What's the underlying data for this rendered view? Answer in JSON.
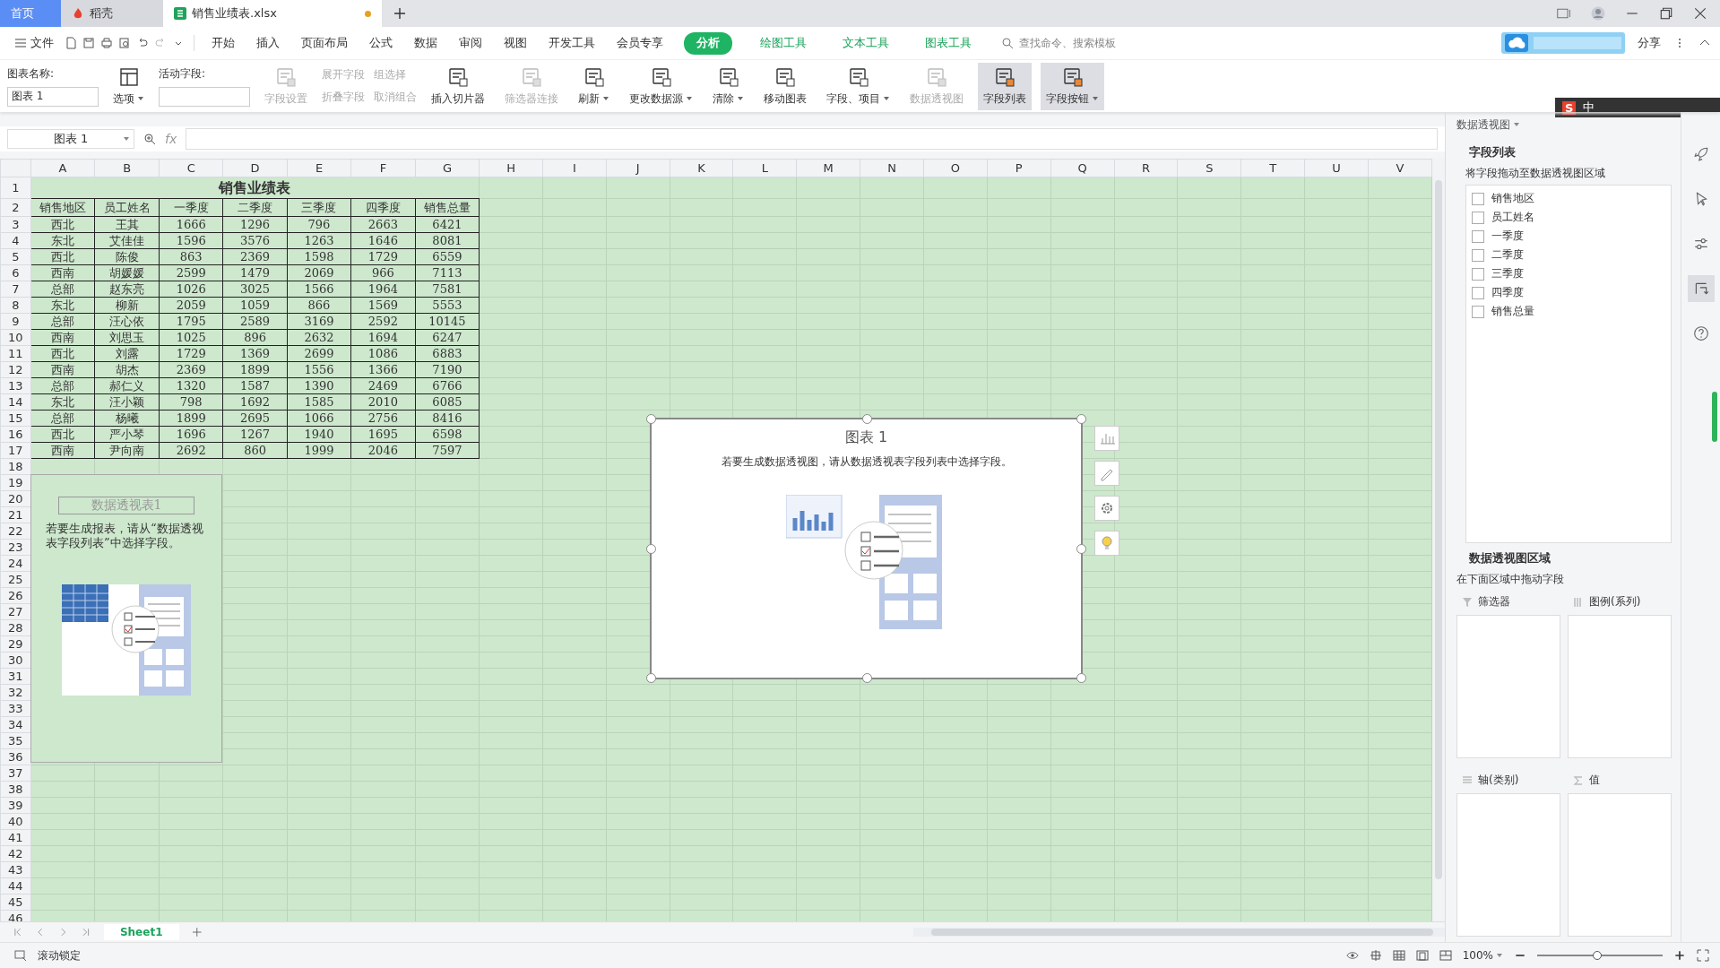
{
  "tabs": [
    {
      "label": "首页",
      "selected": false,
      "kind": "home"
    },
    {
      "label": "稻壳",
      "selected": false,
      "kind": "docer"
    },
    {
      "label": "销售业绩表.xlsx",
      "selected": true,
      "kind": "sheet",
      "unsaved": true
    }
  ],
  "menu": {
    "file": "文件",
    "items": [
      {
        "label": "开始",
        "kind": "normal",
        "selected": false
      },
      {
        "label": "插入",
        "kind": "normal",
        "selected": false
      },
      {
        "label": "页面布局",
        "kind": "normal",
        "selected": false
      },
      {
        "label": "公式",
        "kind": "normal",
        "selected": false
      },
      {
        "label": "数据",
        "kind": "normal",
        "selected": false
      },
      {
        "label": "审阅",
        "kind": "normal",
        "selected": false
      },
      {
        "label": "视图",
        "kind": "normal",
        "selected": false
      },
      {
        "label": "开发工具",
        "kind": "normal",
        "selected": false
      },
      {
        "label": "会员专享",
        "kind": "normal",
        "selected": false
      },
      {
        "label": "分析",
        "kind": "context",
        "selected": true
      },
      {
        "label": "绘图工具",
        "kind": "context",
        "selected": false
      },
      {
        "label": "文本工具",
        "kind": "context",
        "selected": false
      },
      {
        "label": "图表工具",
        "kind": "context",
        "selected": false
      }
    ],
    "search_placeholder": "查找命令、搜索模板",
    "share": "分享"
  },
  "ribbon": {
    "chart_name_label": "图表名称:",
    "chart_name_value": "图表 1",
    "options": "选项",
    "active_field_label": "活动字段:",
    "small_buttons": [
      {
        "label": "展开字段",
        "disabled": true
      },
      {
        "label": "折叠字段",
        "disabled": true
      },
      {
        "label": "组选择",
        "disabled": true
      },
      {
        "label": "取消组合",
        "disabled": true
      }
    ],
    "buttons": [
      {
        "label": "字段设置",
        "disabled": true,
        "dropdown": false,
        "selected": false
      },
      {
        "label": "插入切片器",
        "disabled": false,
        "dropdown": false,
        "selected": false
      },
      {
        "label": "筛选器连接",
        "disabled": true,
        "dropdown": false,
        "selected": false
      },
      {
        "label": "刷新",
        "disabled": false,
        "dropdown": true,
        "selected": false
      },
      {
        "label": "更改数据源",
        "disabled": false,
        "dropdown": true,
        "selected": false
      },
      {
        "label": "清除",
        "disabled": false,
        "dropdown": true,
        "selected": false
      },
      {
        "label": "移动图表",
        "disabled": false,
        "dropdown": false,
        "selected": false
      },
      {
        "label": "字段、项目",
        "disabled": false,
        "dropdown": true,
        "selected": false
      },
      {
        "label": "数据透视图",
        "disabled": true,
        "dropdown": false,
        "selected": false
      },
      {
        "label": "字段列表",
        "disabled": false,
        "dropdown": false,
        "selected": true
      },
      {
        "label": "字段按钮",
        "disabled": false,
        "dropdown": true,
        "selected": true
      }
    ]
  },
  "formula_bar": {
    "name_box": "图表 1",
    "fx": "fx"
  },
  "sheet": {
    "columns": [
      "A",
      "B",
      "C",
      "D",
      "E",
      "F",
      "G",
      "H",
      "I",
      "J",
      "K",
      "L",
      "M",
      "N",
      "O",
      "P",
      "Q",
      "R",
      "S",
      "T",
      "U",
      "V"
    ],
    "row_numbers": [
      "1",
      "2",
      "3",
      "4",
      "5",
      "6",
      "7",
      "8",
      "9",
      "10",
      "11",
      "12",
      "13",
      "14",
      "15",
      "16",
      "17",
      "18",
      "19",
      "20",
      "21",
      "22",
      "23",
      "24",
      "25",
      "26",
      "27",
      "28",
      "29",
      "30",
      "31",
      "32",
      "33",
      "34",
      "35",
      "36",
      "37",
      "38",
      "39",
      "40",
      "41",
      "42",
      "43",
      "44",
      "45",
      "46"
    ],
    "title": "销售业绩表",
    "header": [
      "销售地区",
      "员工姓名",
      "一季度",
      "二季度",
      "三季度",
      "四季度",
      "销售总量"
    ],
    "rows": [
      [
        "西北",
        "王其",
        "1666",
        "1296",
        "796",
        "2663",
        "6421"
      ],
      [
        "东北",
        "艾佳佳",
        "1596",
        "3576",
        "1263",
        "1646",
        "8081"
      ],
      [
        "西北",
        "陈俊",
        "863",
        "2369",
        "1598",
        "1729",
        "6559"
      ],
      [
        "西南",
        "胡媛媛",
        "2599",
        "1479",
        "2069",
        "966",
        "7113"
      ],
      [
        "总部",
        "赵东亮",
        "1026",
        "3025",
        "1566",
        "1964",
        "7581"
      ],
      [
        "东北",
        "柳新",
        "2059",
        "1059",
        "866",
        "1569",
        "5553"
      ],
      [
        "总部",
        "汪心依",
        "1795",
        "2589",
        "3169",
        "2592",
        "10145"
      ],
      [
        "西南",
        "刘思玉",
        "1025",
        "896",
        "2632",
        "1694",
        "6247"
      ],
      [
        "西北",
        "刘露",
        "1729",
        "1369",
        "2699",
        "1086",
        "6883"
      ],
      [
        "西南",
        "胡杰",
        "2369",
        "1899",
        "1556",
        "1366",
        "7190"
      ],
      [
        "总部",
        "郝仁义",
        "1320",
        "1587",
        "1390",
        "2469",
        "6766"
      ],
      [
        "东北",
        "汪小颖",
        "798",
        "1692",
        "1585",
        "2010",
        "6085"
      ],
      [
        "总部",
        "杨曦",
        "1899",
        "2695",
        "1066",
        "2756",
        "8416"
      ],
      [
        "西北",
        "严小琴",
        "1696",
        "1267",
        "1940",
        "1695",
        "6598"
      ],
      [
        "西南",
        "尹向南",
        "2692",
        "860",
        "1999",
        "2046",
        "7597"
      ]
    ]
  },
  "pivot_table": {
    "title": "数据透视表1",
    "message": "若要生成报表，请从“数据透视表字段列表”中选择字段。"
  },
  "chart": {
    "title": "图表 1",
    "message": "若要生成数据透视图，请从数据透视表字段列表中选择字段。"
  },
  "panel": {
    "title": "数据透视图",
    "field_section": "字段列表",
    "field_hint": "将字段拖动至数据透视图区域",
    "fields": [
      {
        "label": "销售地区",
        "checked": false
      },
      {
        "label": "员工姓名",
        "checked": false
      },
      {
        "label": "一季度",
        "checked": false
      },
      {
        "label": "二季度",
        "checked": false
      },
      {
        "label": "三季度",
        "checked": false
      },
      {
        "label": "四季度",
        "checked": false
      },
      {
        "label": "销售总量",
        "checked": false
      }
    ],
    "area_section": "数据透视图区域",
    "area_hint": "在下面区域中拖动字段",
    "areas": [
      {
        "label": "筛选器",
        "kind": "filter"
      },
      {
        "label": "图例(系列)",
        "kind": "legend"
      },
      {
        "label": "轴(类别)",
        "kind": "axis"
      },
      {
        "label": "值",
        "kind": "value"
      }
    ]
  },
  "sheet_tabs": [
    {
      "label": "Sheet1",
      "selected": true
    }
  ],
  "status": {
    "scroll_lock": "滚动锁定",
    "zoom": "100%",
    "zoom_slider": {
      "level": 0.48
    }
  },
  "ime": {
    "logo": "S",
    "label": "中"
  }
}
